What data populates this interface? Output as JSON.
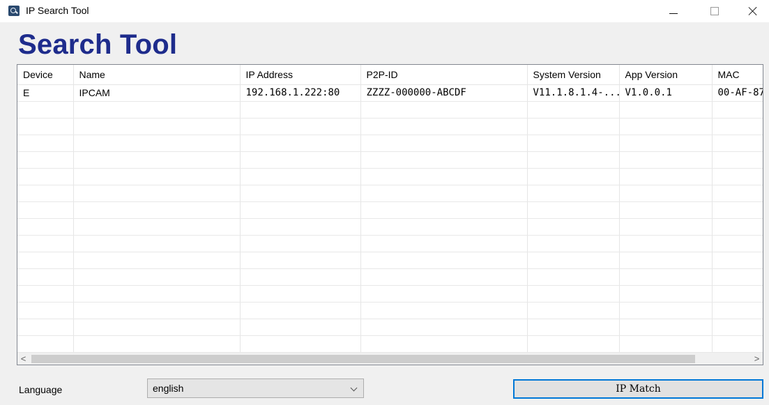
{
  "window": {
    "title": "IP Search Tool",
    "minimize_label": "–",
    "maximize_label": "□",
    "close_label": "×"
  },
  "banner": {
    "title": "Search Tool"
  },
  "table": {
    "columns": [
      "Device",
      "Name",
      "IP Address",
      "P2P-ID",
      "System Version",
      "App Version",
      "MAC"
    ],
    "rows": [
      [
        "E",
        "IPCAM",
        "192.168.1.222:80",
        "ZZZZ-000000-ABCDF",
        "V11.1.8.1.4-...",
        "V1.0.0.1",
        "00-AF-87"
      ]
    ],
    "empty_rows": 15
  },
  "scrollbar": {
    "left_arrow": "<",
    "right_arrow": ">"
  },
  "footer": {
    "language_label": "Language",
    "language_value": "english",
    "ip_match_label": "IP Match"
  },
  "colors": {
    "banner": "#1e2c8c",
    "button_border": "#0078d7",
    "window_bg": "#f0f0f0"
  }
}
